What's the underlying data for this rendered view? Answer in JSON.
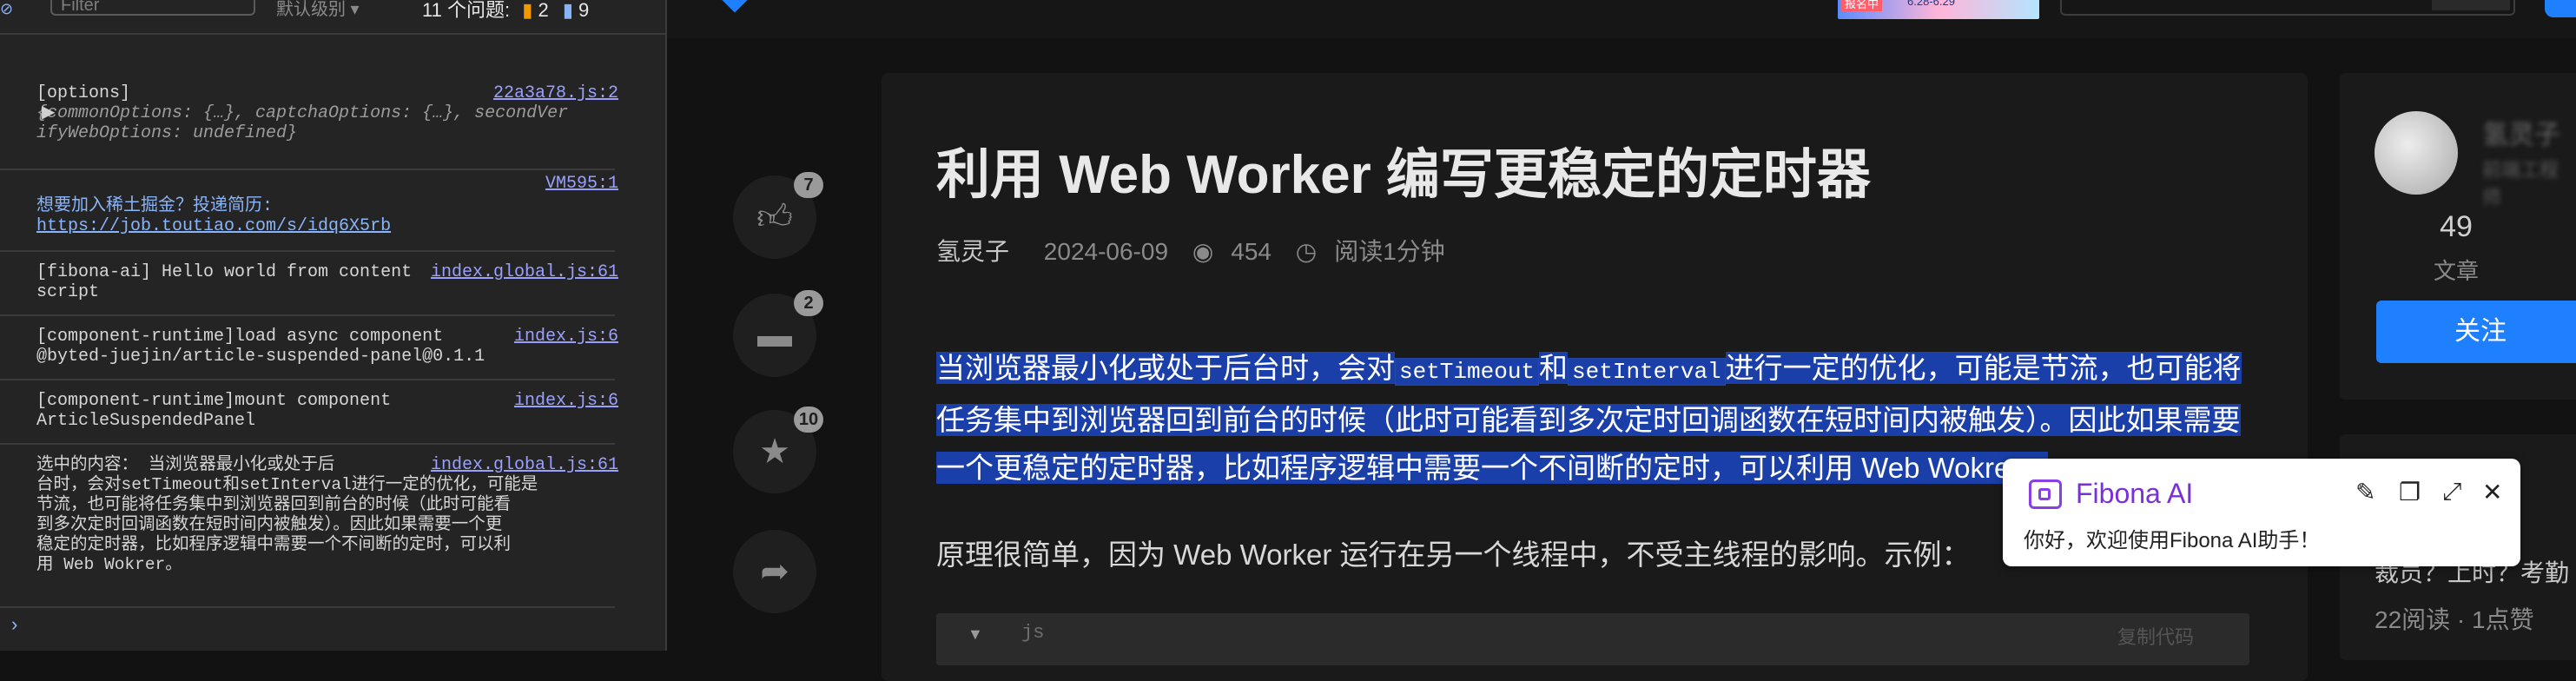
{
  "devtools": {
    "filter_placeholder": "Filter",
    "level_label": "默认级别 ▾",
    "issues_label": "11 个问题:",
    "issues_warnings": "2",
    "issues_info": "9",
    "entries": [
      {
        "line1": "[options]",
        "line2": "{commonOptions: {…}, captchaOptions: {…}, secondVer",
        "line3": "ifyWebOptions: undefined}",
        "source": "22a3a78.js:2"
      },
      {
        "source": "VM595:1",
        "line1": "想要加入稀土掘金？投递简历:",
        "line2": "https://job.toutiao.com/s/idq6X5rb"
      },
      {
        "line1": "[fibona-ai] Hello world from content",
        "line2": "script",
        "source": "index.global.js:61"
      },
      {
        "line1": "[component-runtime]load async component",
        "line2": "@byted-juejin/article-suspended-panel@0.1.1",
        "source": "index.js:6"
      },
      {
        "line1": "[component-runtime]mount component",
        "line2": "ArticleSuspendedPanel",
        "source": "index.js:6"
      },
      {
        "source": "index.global.js:61",
        "lines": [
          "选中的内容： 当浏览器最小化或处于后",
          "台时，会对setTimeout和setInterval进行一定的优化，可能是",
          "节流，也可能将任务集中到浏览器回到前台的时候（此时可能看",
          "到多次定时回调函数在短时间内被触发）。因此如果需要一个更",
          "稳定的定时器，比如程序逻辑中需要一个不间断的定时，可以利",
          "用 Web Wokrer。"
        ]
      }
    ],
    "prompt": "›"
  },
  "site": {
    "banner_tag": "报名中",
    "banner_date": "6.28-6.29"
  },
  "actions": [
    {
      "name": "like",
      "icon": "thumbs-up-icon",
      "count": "7"
    },
    {
      "name": "comment",
      "icon": "comment-icon",
      "count": "2"
    },
    {
      "name": "collect",
      "icon": "star-icon",
      "count": "10"
    },
    {
      "name": "share",
      "icon": "share-icon",
      "count": ""
    }
  ],
  "article": {
    "title": "利用 Web Worker 编写更稳定的定时器",
    "author": "氢灵子",
    "date": "2024-06-09",
    "views": "454",
    "read_time": "阅读1分钟",
    "sel_part1": "当浏览器最小化或处于后台时，会对",
    "sel_code1": "setTimeout",
    "sel_part2": "和",
    "sel_code2": "setInterval",
    "sel_part3": "进行一定的优化，可能是节流，也可能将任务集中到浏览器回到前台的时候（此时可能看到多次定时回调函数在短时间内被触发）。因此如果需要一个更稳定的定时器，比如程序逻辑中需要一个不间断的定时，可以利用 Web Wokrer。",
    "paragraph2": "原理很简单，因为 Web Worker 运行在另一个线程中，不受主线程的影响。示例：",
    "code_lang": "js",
    "copy_label": "复制代码"
  },
  "author_panel": {
    "articles_count": "49",
    "articles_label": "文章",
    "follow_label": "关注"
  },
  "related": {
    "title": "裁员？上时？考勤",
    "meta": "22阅读 · 1点赞"
  },
  "fibona": {
    "name": "Fibona AI",
    "message": "你好，欢迎使用Fibona AI助手！"
  },
  "colors": {
    "accent": "#1e80ff",
    "selection": "#1a3fa8",
    "fibona": "#7b2fd6"
  }
}
